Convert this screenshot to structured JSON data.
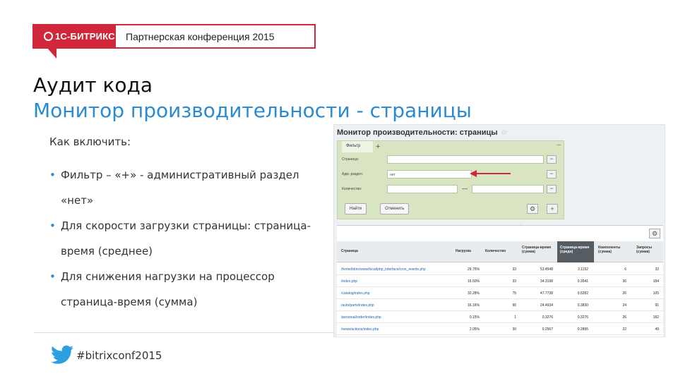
{
  "header": {
    "logo_text": "1С-БИТРИКС",
    "conference": "Партнерская конференция 2015"
  },
  "title": "Аудит кода",
  "subtitle": "Монитор производительности - страницы",
  "how_label": "Как включить:",
  "bullets": [
    "Фильтр – «+» - административный раздел «нет»",
    "Для скорости загрузки страницы: страница-время (среднее)",
    "Для снижения нагрузки на процессор страница-время (сумма)"
  ],
  "footer": {
    "hashtag": "#bitrixconf2015",
    "icon": "twitter-bird-icon"
  },
  "screenshot": {
    "title": "Монитор производительности: страницы",
    "filter": {
      "tab": "Фильтр",
      "rows": [
        {
          "label": "Страница:",
          "value": ""
        },
        {
          "label": "Адм. раздел:",
          "value": "нет"
        },
        {
          "label": "Количество:",
          "value": ""
        }
      ],
      "find_button": "Найти",
      "cancel_button": "Отменить"
    },
    "columns": [
      "Страница",
      "Нагрузка",
      "Количество",
      "Страница-время (сумма)",
      "Страница-время (средн)",
      "Компоненты (сумма)",
      "Запросы (сумма)"
    ],
    "rows": [
      [
        "/home/bitrix/www/local/php_interface/cron_events.php",
        "29.75%",
        "33",
        "53.4548",
        "2.1152",
        "6",
        "32"
      ],
      [
        "/index.php",
        "16.50%",
        "33",
        "34.3198",
        "0.3541",
        "36",
        "184"
      ],
      [
        "/catalog/index.php",
        "32.28%",
        "75",
        "47.7738",
        "0.5282",
        "26",
        "105"
      ],
      [
        "/auto/parts/index.php",
        "16.16%",
        "90",
        "24.4934",
        "0.3830",
        "24",
        "91"
      ],
      [
        "/personal/order/index.php",
        "0.15%",
        "1",
        "0.3276",
        "0.3276",
        "26",
        "182"
      ],
      [
        "/news/actions/index.php",
        "2.05%",
        "30",
        "0.2567",
        "0.2895",
        "22",
        "49"
      ]
    ],
    "accent_arrow_color": "#d0283a"
  },
  "colors": {
    "brand_red": "#d0283a",
    "accent_blue": "#2c8ad0"
  }
}
